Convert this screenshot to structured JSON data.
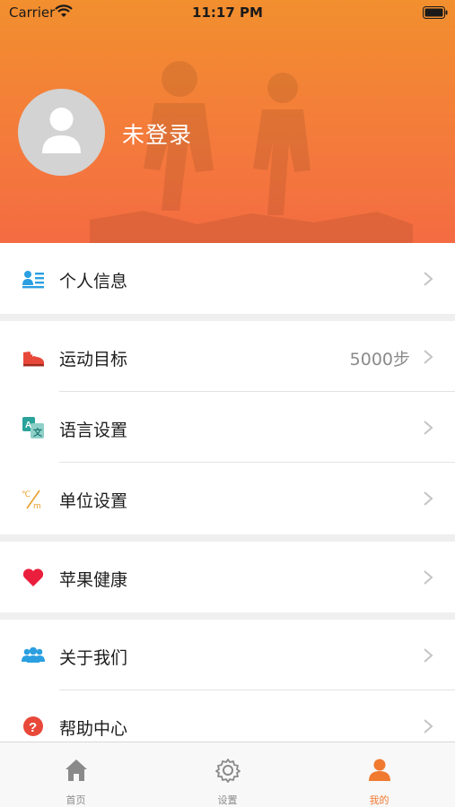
{
  "status_bar": {
    "carrier": "Carrier",
    "time": "11:17 PM"
  },
  "profile": {
    "name": "未登录"
  },
  "menu": {
    "personal_info": {
      "label": "个人信息"
    },
    "sport_goal": {
      "label": "运动目标",
      "value": "5000步"
    },
    "language": {
      "label": "语言设置"
    },
    "unit": {
      "label": "单位设置"
    },
    "apple_health": {
      "label": "苹果健康"
    },
    "about": {
      "label": "关于我们"
    },
    "help": {
      "label": "帮助中心"
    }
  },
  "tabbar": {
    "items": [
      {
        "label": "首页"
      },
      {
        "label": "设置"
      },
      {
        "label": "我的"
      }
    ],
    "active_color": "#f07a30"
  },
  "colors": {
    "header_top": "#f28f2e",
    "header_bottom": "#f46b42"
  }
}
